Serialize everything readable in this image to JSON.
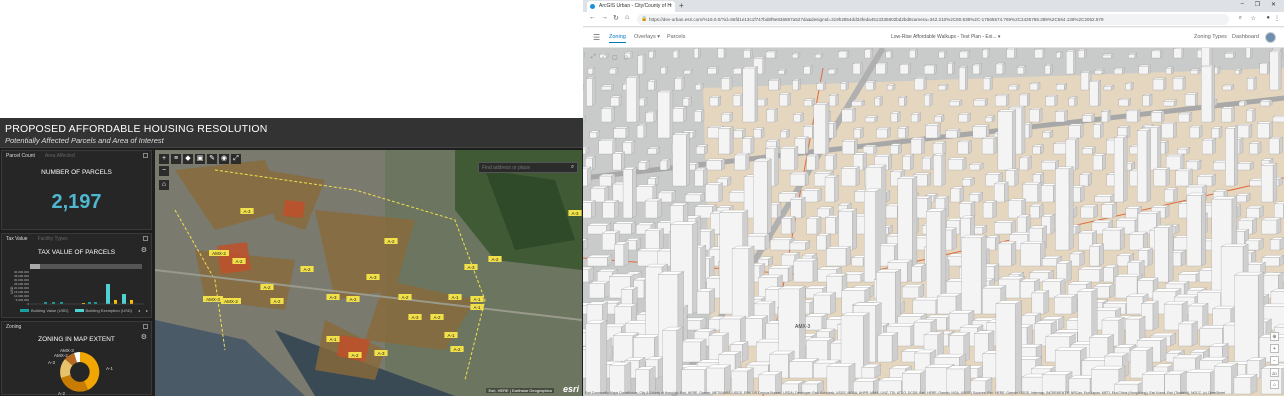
{
  "dashboard": {
    "title": "PROPOSED AFFORDABLE HOUSING RESOLUTION",
    "subtitle": "Potentially Affected Parcels and Area of Interest",
    "count_panel": {
      "tabs": [
        "Parcel Count",
        "Area Affected"
      ],
      "label": "NUMBER OF PARCELS",
      "value": "2,197"
    },
    "tax_panel": {
      "tabs": [
        "Tax Value",
        "Facility Types"
      ],
      "label": "TAX VALUE OF PARCELS",
      "y_axis_label": "USD",
      "y_ticks": [
        "40,000,000",
        "35,000,000",
        "30,000,000",
        "25,000,000",
        "20,000,000",
        "15,000,000",
        "10,000,000",
        "5,000,000",
        "0"
      ],
      "legend": [
        "Building Value (USD)",
        "Building Exemption (USD)"
      ],
      "colors": [
        "#1b9e9e",
        "#4fd1d1",
        "#f5c400"
      ]
    },
    "zone_panel": {
      "tabs": [
        "Zoning"
      ],
      "label": "ZONING IN MAP EXTENT",
      "slice_labels": [
        "AMX-3",
        "AMX-2",
        "A-3",
        "A-1",
        "A-2"
      ]
    },
    "map": {
      "search_placeholder": "Find address or place",
      "attribution": "Esri, HERE | Earthstar Geographics",
      "logo": "esri",
      "zone_labels": [
        "A-3",
        "AMX-2",
        "A-2",
        "A-2",
        "AMX-3",
        "AMX-2",
        "A-2",
        "A-2",
        "A-1",
        "A-3",
        "A-2",
        "A-3",
        "A-2",
        "A-1",
        "A-2",
        "A-3",
        "A-2",
        "A-1",
        "A-2",
        "A-3",
        "A-2",
        "A-3",
        "A-2",
        "A-1",
        "A-3",
        "A-1"
      ],
      "toolbar_icons": [
        "plus-icon",
        "minus-icon",
        "home-icon",
        "layers-icon",
        "measure-icon",
        "select-icon",
        "draw-icon",
        "eye-icon",
        "expand-icon"
      ]
    }
  },
  "browser": {
    "tab_title": "ArcGIS Urban - City/County of H",
    "url": "https://dev-urban.esri.com/%19.0.0/?id=56fd1e13c1f747bd8f9e836597a527da&designId=319h2854dd34feda4513335602bd2bd8camera=342.210%2C60.838%2C-17565574.769%2C2425788.389%2C564.138%2C2052.579",
    "app_nav": [
      "Zoning",
      "Overlays",
      "Parcels"
    ],
    "plan_select": "Low-Rise Affordable Walkups - Test Plan - Exi...",
    "right_nav": [
      "Zoning Types",
      "Dashboard"
    ],
    "scene_label": "AMX-3",
    "scene_attribution": "Esri Community Maps Contributors, City & County of Honolulu, Esri, HERE, Garmin, METI/NASA, USGS, EPA, US Census Bureau, USDA | Developer: Esri, Autodesk, USGS, NOAA, AHPR, MNIA, LINZ, TDI, ATCO, DCDB, Esri, HERE, Garmin, NGA, USGS | Sources: Esri, HERE, Garmin, USGS, Intermap, INCREMENT P, NRCan, Esri Japan, METI, Esri China (Hong Kong), Esri Korea, Esri (Thailand), NGCC, (c) OpenStreetMap contributors, and the GIS User Community"
  }
}
